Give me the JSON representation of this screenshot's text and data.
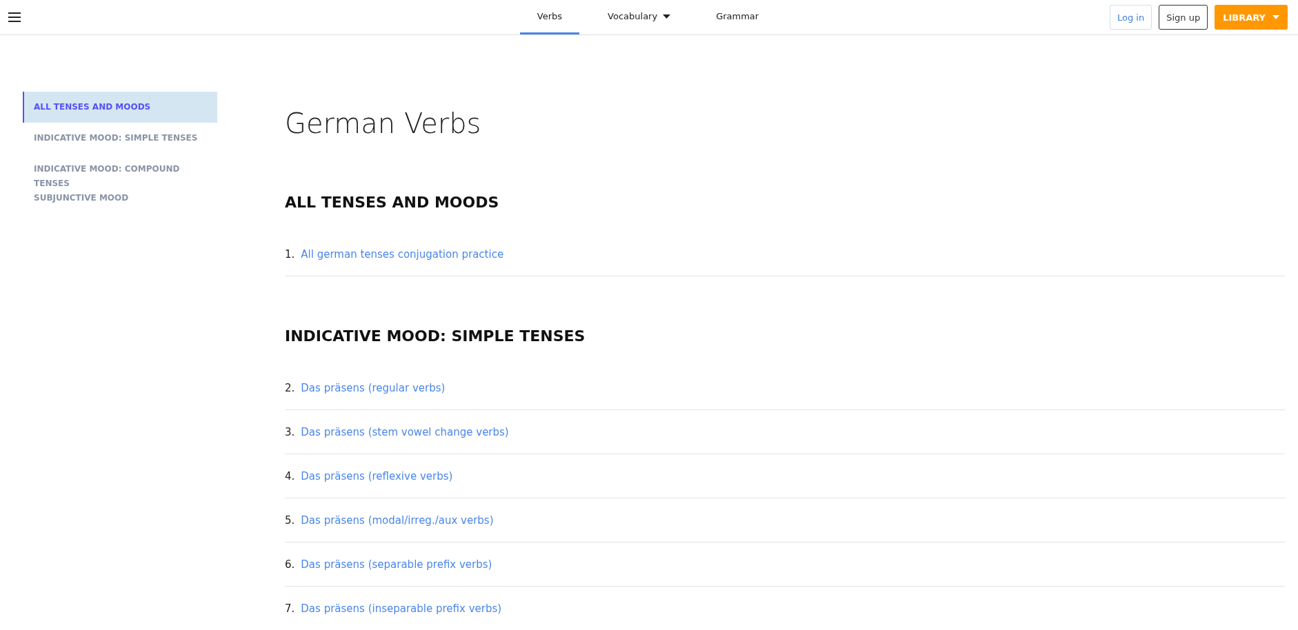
{
  "nav": {
    "tabs": [
      {
        "label": "Verbs",
        "selected": true,
        "has_menu": false
      },
      {
        "label": "Vocabulary",
        "selected": false,
        "has_menu": true
      },
      {
        "label": "Grammar",
        "selected": false,
        "has_menu": false
      }
    ],
    "buttons": [
      {
        "label": "Log in",
        "kind": "outline"
      },
      {
        "label": "Sign up",
        "kind": "dark-outline"
      },
      {
        "label": "LIBRARY",
        "kind": "primary-menu"
      }
    ]
  },
  "sidebar": {
    "items": [
      {
        "label": "ALL TENSES AND MOODS",
        "selected": true
      },
      {
        "label": "INDICATIVE MOOD: SIMPLE TENSES",
        "selected": false
      },
      {
        "label": "INDICATIVE MOOD: COMPOUND TENSES",
        "selected": false
      },
      {
        "label": "SUBJUNCTIVE MOOD",
        "selected": false
      }
    ]
  },
  "title": "German Verbs",
  "sections": [
    {
      "heading": "ALL TENSES AND MOODS",
      "items": [
        {
          "number": "1.",
          "text": "All german tenses conjugation practice"
        }
      ]
    },
    {
      "heading": "INDICATIVE MOOD: SIMPLE TENSES",
      "items": [
        {
          "number": "2.",
          "text": "Das präsens (regular verbs)"
        },
        {
          "number": "3.",
          "text": "Das präsens (stem vowel change verbs)"
        },
        {
          "number": "4.",
          "text": "Das präsens (reflexive verbs)"
        },
        {
          "number": "5.",
          "text": "Das präsens (modal/irreg./aux verbs)"
        },
        {
          "number": "6.",
          "text": "Das präsens (separable prefix verbs)"
        },
        {
          "number": "7.",
          "text": "Das präsens (inseparable prefix verbs)"
        }
      ]
    }
  ]
}
